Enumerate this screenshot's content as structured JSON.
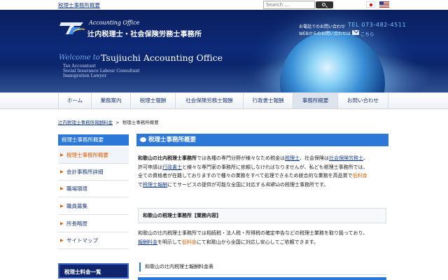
{
  "topbar": {
    "site_link": "税理士事務所概要",
    "search_placeholder": "Search ...",
    "lang_flags": [
      "japan-flag-icon",
      "usa-flag-icon"
    ]
  },
  "header": {
    "logo_en": "Accounting Office",
    "logo_jp": "辻内税理士・社会保険労務士事務所",
    "contact_phone_label": "お電話でのお問い合わせ",
    "contact_phone": "TEL 073-482-4511",
    "contact_web_label": "WEBからのお問い合わせは",
    "contact_web_link": "こちら",
    "welcome": "Welcome to",
    "office_name": "Tsujiuchi Accounting Office",
    "taglines": [
      "Tax Accountant",
      "Social Insurance Labour Consultant",
      "Immigration Lawyer"
    ]
  },
  "nav": {
    "items": [
      "ホーム",
      "業務案内",
      "税理士報酬",
      "社会保険労務士報酬",
      "行政書士報酬",
      "事務所概要",
      "お問い合わせ"
    ],
    "active_index": 5
  },
  "breadcrumb": {
    "link": "辻内税理士事務所報酬料金",
    "separator": ">",
    "current": "税理士事務所概要"
  },
  "sidebar": {
    "heading": "税理士事務所概要",
    "items": [
      "税理士事務所概要",
      "会計事務所詳細",
      "職場環境",
      "職員募集",
      "所長略歴",
      "サイトマップ"
    ],
    "active_index": 0,
    "box2": "税理士料金一覧"
  },
  "main": {
    "heading": "税理士事務所概要",
    "p1": {
      "s1": "和歌山の辻内税理士事務所",
      "s2": "では各種の専門分野が様々なため税金は",
      "l1": "税理士",
      "s3": "、社会保険は",
      "l2": "社会保険労務士",
      "s4": "、",
      "s5": "許可申請は",
      "l3": "行政書士",
      "s6": "と様々な専門家の事務所に依頼しなければなりませんが、私ども税理士事務所では、",
      "s7": "全ての資格者が在籍しておりますので種々の業務をすべて処理できるため統合的な業務を高品質で",
      "o1": "低料金",
      "s8": "で",
      "l4": "税理士報酬",
      "s9": "にてサービスの提供が可能な全国に対応する",
      "s10": "和歌山",
      "s11": "の税理士事務所です。"
    },
    "sub_heading": "和歌山の税理士事務所【業務内容】",
    "p2": {
      "s1": "和歌山の辻内税理士事務所では相続税・法人税・所得税の確定申告などの税理士業務を取り扱っており、",
      "l1": "報酬料金",
      "s2": "を明示して",
      "o1": "低料金",
      "s3": "にて和歌山から全国に対応し安心してご依頼できます。"
    },
    "table_heading": "和歌山の辻内税理士報酬料金表"
  },
  "colors": {
    "accent_blue": "#2b78d8",
    "header_navy": "#0d2a78",
    "link_blue": "#1a3f8a",
    "highlight_orange": "#e05a00"
  }
}
